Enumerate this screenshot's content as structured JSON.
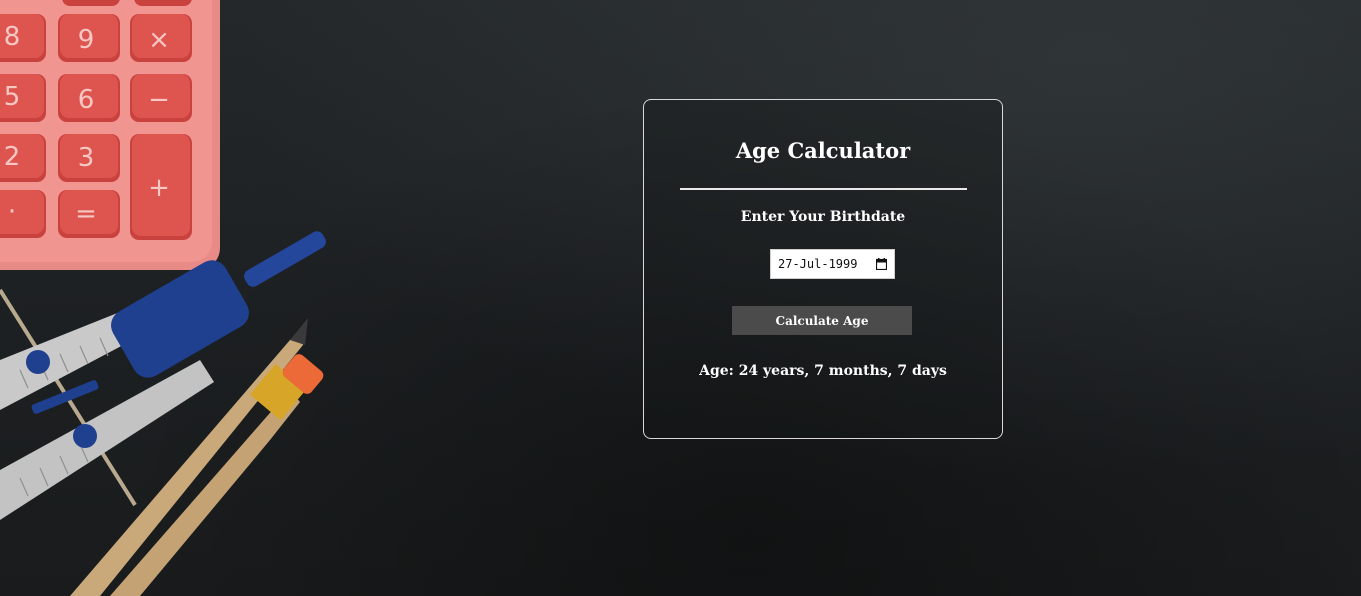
{
  "page": {
    "title": "Age Calculator",
    "subtitle": "Enter Your Birthdate",
    "birthdate_value": "27-Jul-1999",
    "button_label": "Calculate Age",
    "result_text": "Age: 24 years, 7 months, 7 days"
  },
  "background": {
    "objects": [
      "calculator",
      "compass",
      "pencil",
      "pencil"
    ],
    "calculator_keys": [
      "8",
      "9",
      "×",
      "5",
      "6",
      "−",
      "2",
      "3",
      "+",
      "·",
      "="
    ]
  },
  "colors": {
    "background": "#1c1f21",
    "card_border": "#d8d8d8",
    "text": "#ffffff",
    "button_bg": "#4b4b4b",
    "calculator_body": "#e88a86",
    "calculator_key": "#d94f4a",
    "compass_blue": "#1f3f8f"
  },
  "icons": {
    "date_picker": "calendar-icon"
  }
}
